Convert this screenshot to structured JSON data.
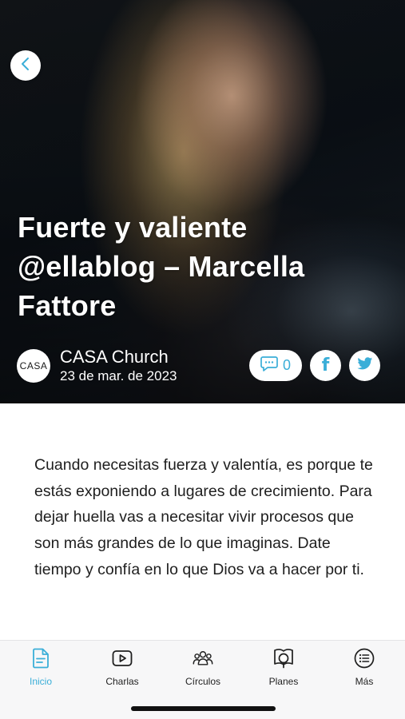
{
  "article": {
    "title": "Fuerte y valiente @ellablog – Marcella Fattore",
    "author": "CASA Church",
    "avatar_text": "CASA",
    "date": "23 de mar. de 2023",
    "comment_count": "0",
    "body": "Cuando necesitas fuerza y valentía, es porque te estás exponiendo a lugares de crecimiento. Para dejar huella vas a necesitar vivir procesos que son más grandes de lo que imaginas. Date tiempo y confía en lo que Dios va a hacer por ti."
  },
  "icons": {
    "back": "chevron-left-icon",
    "comment": "comment-icon",
    "facebook": "facebook-icon",
    "twitter": "twitter-icon"
  },
  "tabbar": {
    "tabs": [
      {
        "label": "Inicio",
        "icon": "document-icon",
        "active": true
      },
      {
        "label": "Charlas",
        "icon": "play-icon",
        "active": false
      },
      {
        "label": "Círculos",
        "icon": "people-icon",
        "active": false
      },
      {
        "label": "Planes",
        "icon": "book-icon",
        "active": false
      },
      {
        "label": "Más",
        "icon": "list-icon",
        "active": false
      }
    ]
  },
  "colors": {
    "accent": "#3aaed8",
    "text": "#1e1e1e",
    "tabbar_bg": "#f7f7f8"
  }
}
